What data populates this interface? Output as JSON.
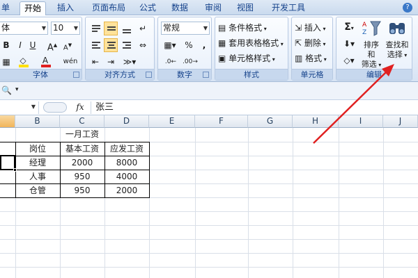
{
  "tabs": [
    "单",
    "开始",
    "插入",
    "页面布局",
    "公式",
    "数据",
    "审阅",
    "视图",
    "开发工具"
  ],
  "active_tab": "开始",
  "help_icon": "?",
  "font_group": {
    "font_name": "体",
    "font_size": "10",
    "label": "字体"
  },
  "align_group": {
    "label": "对齐方式"
  },
  "number_group": {
    "format": "常规",
    "percent": "%",
    "comma": ",",
    "label": "数字"
  },
  "style_group": {
    "cond_format": "条件格式",
    "table_format": "套用表格格式",
    "cell_style": "单元格样式",
    "label": "样式"
  },
  "cells_group": {
    "insert": "插入",
    "delete": "删除",
    "format": "格式",
    "label": "单元格"
  },
  "edit_group": {
    "sum": "Σ",
    "sort_filter_1": "排序和",
    "sort_filter_2": "筛选",
    "find_select_1": "查找和",
    "find_select_2": "选择",
    "label": "编辑"
  },
  "formula_bar": {
    "fx": "fx",
    "value": "张三"
  },
  "columns": [
    "B",
    "C",
    "D",
    "E",
    "F",
    "G",
    "H",
    "I",
    "J"
  ],
  "table": {
    "title": "一月工资",
    "headers": [
      "岗位",
      "基本工资",
      "应发工资"
    ],
    "rows": [
      [
        "经理",
        "2000",
        "8000"
      ],
      [
        "人事",
        "950",
        "4000"
      ],
      [
        "仓管",
        "950",
        "2000"
      ]
    ]
  },
  "colors": {
    "accent": "#15428b",
    "annotation_arrow": "#e02020",
    "active_tab_text": "#000000"
  }
}
